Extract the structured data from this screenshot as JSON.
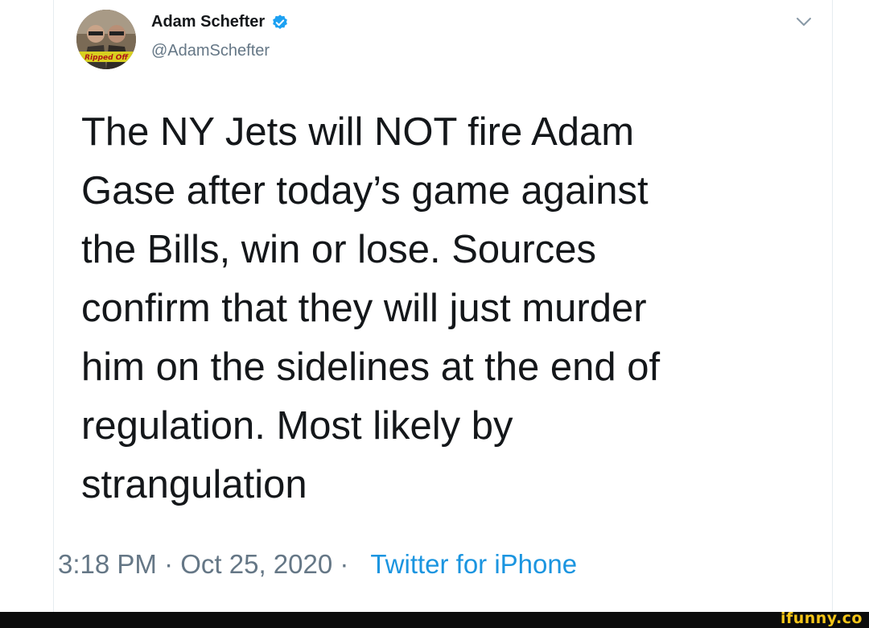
{
  "tweet": {
    "author_name": "Adam Schefter",
    "author_handle": "@AdamSchefter",
    "avatar_text": "Ripped Off",
    "text": "The NY Jets will NOT fire Adam\nGase after today’s game against\nthe Bills, win or lose. Sources\nconfirm that they will just murder\nhim on the sidelines at the end of\nregulation. Most likely by\nstrangulation",
    "time": "3:18 PM",
    "date": "Oct 25, 2020",
    "separator": "·",
    "source": "Twitter for iPhone"
  },
  "icons": {
    "verified": "verified-badge-icon",
    "menu": "chevron-down-icon"
  },
  "colors": {
    "name": "#14171a",
    "secondary": "#657786",
    "link": "#1b95e0",
    "verified": "#1da1f2",
    "watermark": "#f5c518"
  },
  "watermark": {
    "text": "ifunny.co"
  }
}
